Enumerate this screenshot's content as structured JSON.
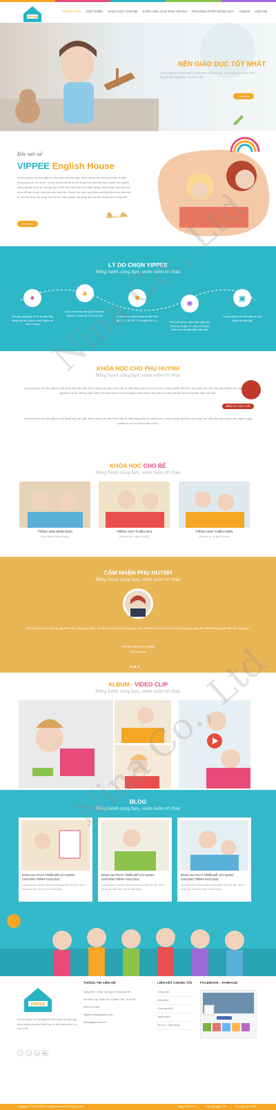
{
  "brand": {
    "name": "YIPPEE",
    "tagline": "English House"
  },
  "nav": [
    "TRANG CHỦ",
    "GIỚI THIỆU",
    "KHÓA HỌC CHO BÉ",
    "KHÓA HỌC CHO PHỤ HUYNH",
    "PHƯƠNG PHÁP GIẢNG DẠY",
    "ALBUM",
    "LIÊN HỆ"
  ],
  "hero": {
    "title": "NỀN GIÁO DỤC TỐT NHẤT",
    "text": "Lorem Ipsum chỉ đơn giản là một đoạn văn bản giả, được dùng vào việc trình bày và dàn trang phục vụ cho in ấn.",
    "button": "Xem thêm"
  },
  "intro": {
    "pre": "Đôi nét về",
    "title_a": "VIPPEE",
    "title_b": "English House",
    "text": "Lorem Ipsum chỉ đơn giản là một đoạn văn bản giả, được dùng vào việc trình bày và dàn trang phục vụ cho in ấn. Lorem Ipsum đã được sử dụng như một văn bản chuẩn cho ngành công nghiệp in ấn từ những năm 1500, khi một họa sĩ vô danh ghép nhiều đoạn văn bản với nhau để tạo thành một bản mẫu văn bản. Đoạn văn bản này không những đã tồn tại năm thế kỉ, mà khi được áp dụng vào tin học văn phòng, nội dung của nó vẫn không hề bị thay đổi.",
    "button": "Xem thêm"
  },
  "why": {
    "title": "LÝ DO CHỌN YIPPEE",
    "subtitle": "Đồng hành cùng bạn, vươn mầm tri thức",
    "items": [
      {
        "icon": "teacher-icon",
        "text": "Nơi duy nhất giúp bé tự tin giao tiếp tiếng Anh với người nước ngoài chỉ sau 6 tháng"
      },
      {
        "icon": "shield-icon",
        "text": "Cam kết bé lấy chứng chỉ Starters, Movers, Flyers từ 12/15 cả lớp"
      },
      {
        "icon": "book-icon",
        "text": "Lộ trình học nhanh giúp bé đạt trình độ C1 (~ IELTS 7.0) chuẩn Hồ Ch..."
      },
      {
        "icon": "color-wheel-icon",
        "text": "Môi trường học ngôn ngữ, giàu yêu thương và gắn bó, giúp bé thông minh hơn và phát triển toàn diện"
      },
      {
        "icon": "card-icon",
        "text": "Lorem Ipsum chỉ đơn giản là một đoạn văn bản giả"
      }
    ]
  },
  "parents": {
    "title": "KHÓA HỌC CHO PHỤ HUYNH",
    "subtitle": "Đồng hành cùng bạn, vươn mầm tri thức",
    "p1": "Lorem Ipsum chỉ đơn giản là một đoạn văn bản giả, được dùng vào việc trình bày và dàn trang phục vụ cho in ấn. Lorem Ipsum đã được sử dụng như một văn bản chuẩn cho ngành công nghiệp in ấn từ những năm 1500, khi một họa sĩ vô danh ghép nhiều đoạn văn bản với nhau để tạo thành một bản mẫu văn bản.",
    "p2": "Lorem Ipsum chỉ đơn giản là một đoạn văn bản giả, được dùng vào việc trình bày và dàn trang phục vụ cho in ấn. Lorem Ipsum đã được sử dụng như một văn bản chuẩn cho ngành công nghiệp in ấn từ những năm 1500.",
    "register": "ĐĂNG KÝ HỌC THỬ"
  },
  "kids": {
    "title_a": "KHÓA HỌC",
    "title_b": "CHO BÉ",
    "subtitle": "Đồng hành cùng bạn, vươn mầm tri thức",
    "cards": [
      {
        "title": "TIẾNG ANH MẦM NON",
        "sub": "(Cho bé từ 3 đến 6 tuổi)"
      },
      {
        "title": "TIẾNG ANH THIẾU NHI",
        "sub": "(Cho bé từ 7 đến 10 tuổi)"
      },
      {
        "title": "TIẾNG ANH THIẾU NIÊN",
        "sub": "(Cho bé từ 11 đến 15 tuổi)"
      }
    ]
  },
  "testimonial": {
    "title": "CẢM NHẬN PHỤ HUYNH",
    "subtitle": "Đồng hành cùng bạn, vươn mầm tri thức",
    "quote": "\"Đơn thuần là một văn bản giả thuần túy, không có nghĩa. Nó được dùng để mô phỏng văn bản, để các nhà thiết kế có thể tập trung vào giao diện mà không bị phân tâm bởi nội dung.\"",
    "name": "PHẠM THỊ THÚY HIỀN",
    "role": "Phụ huynh bé"
  },
  "album": {
    "title_a": "ALBUM",
    "title_b": "VIDEO CLIP",
    "subtitle": "Đồng hành cùng bạn, vươn mầm tri thức"
  },
  "blog": {
    "title": "BLOG",
    "subtitle": "Đồng hành cùng bạn, vươn mầm tri thức",
    "posts": [
      {
        "title": "ĐÁNH GIÁ PHÁT TRIỂN ĐỂ XÂY DỰNG CHƯƠNG TRÌNH GIÁO DỤC",
        "text": "Lorem Ipsum chỉ đơn giản là một đoạn văn bản giả, được dùng vào việc trình bày và dàn trang."
      },
      {
        "title": "ĐÁNH GIÁ PHÁT TRIỂN ĐỂ XÂY DỰNG CHƯƠNG TRÌNH GIÁO DỤC",
        "text": "Lorem Ipsum chỉ đơn giản là một đoạn văn bản giả, được dùng vào việc trình bày và dàn trang."
      },
      {
        "title": "ĐÁNH GIÁ PHÁT TRIỂN ĐỂ XÂY DỰNG CHƯƠNG TRÌNH GIÁO DỤC",
        "text": "Lorem Ipsum chỉ đơn giản là một đoạn văn bản giả, được dùng vào việc trình bày và dàn trang."
      }
    ]
  },
  "footer": {
    "about": "Lorem Ipsum chỉ đơn giản là một đoạn văn bản giả, được dùng vào việc trình bày và dàn trang phục vụ cho in ấn.",
    "contact_title": "THÔNG TIN LIÊN HỆ",
    "contact": [
      "Tầng trệt, Lô Ra, Chung cư Khuông Việt",
      "Hồ Hữu Lạc, P.An Lạc, Q.Bình Tân, Tp.HCM",
      "0909.121.969",
      "Yippee.edu@outlook.com",
      "www.yippee.edu.vn"
    ],
    "links_title": "LIÊN KẾT CHUNG TÔI",
    "links": [
      "Trang chủ",
      "Giới thiệu",
      "Chương trình",
      "Tuyển sinh",
      "Tin tức - Hoạt động"
    ],
    "fanpage_title": "FACEBOOK - FANPAGE",
    "copyright": "Copyright © 2019 YIPPEE. All rights reserved. Design by NINA",
    "stats": [
      "Đang online: 99",
      "Truy cập ngày: 999",
      "Tổng truy cập: 9999"
    ]
  },
  "watermark": "Nina Co., Ltd"
}
